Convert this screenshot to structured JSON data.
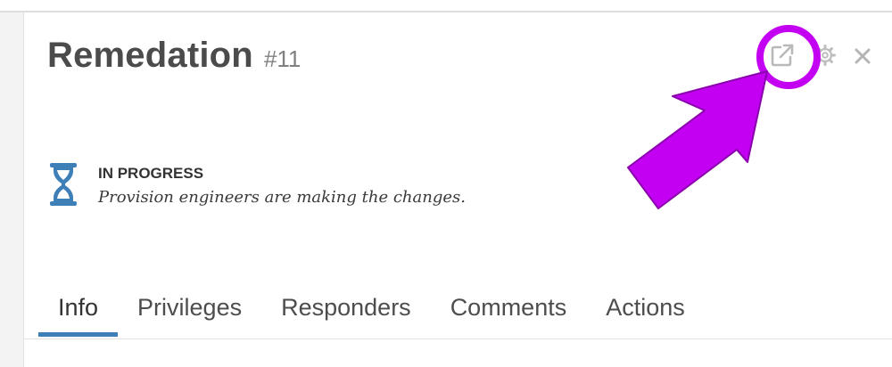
{
  "header": {
    "title": "Remedation",
    "number": "#11",
    "buttons": {
      "external": "external-link-icon",
      "settings": "gear-icon",
      "close": "close-icon"
    }
  },
  "status": {
    "icon": "hourglass-icon",
    "label": "IN PROGRESS",
    "description": "Provision engineers are making the changes."
  },
  "tabs": [
    {
      "label": "Info",
      "active": true
    },
    {
      "label": "Privileges",
      "active": false
    },
    {
      "label": "Responders",
      "active": false
    },
    {
      "label": "Comments",
      "active": false
    },
    {
      "label": "Actions",
      "active": false
    }
  ],
  "colors": {
    "accent": "#3f7fb8",
    "highlight": "#c400f2"
  }
}
